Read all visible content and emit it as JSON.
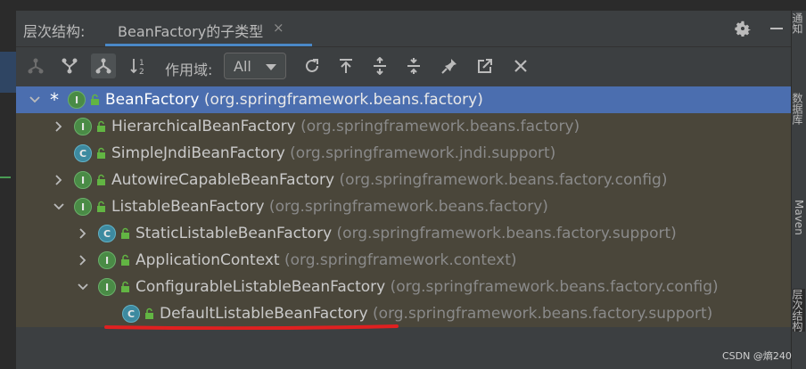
{
  "header": {
    "title": "层次结构:",
    "tab_label": "BeanFactory的子类型",
    "tab_close": "×"
  },
  "toolbar": {
    "scope_label": "作用域:",
    "scope_value": "All"
  },
  "tree": [
    {
      "kind": "I",
      "name": "BeanFactory",
      "pkg": "(org.springframework.beans.factory)",
      "expanded": true,
      "selected": true,
      "star": "*"
    },
    {
      "kind": "I",
      "name": "HierarchicalBeanFactory",
      "pkg": "(org.springframework.beans.factory)",
      "expanded": false
    },
    {
      "kind": "C",
      "name": "SimpleJndiBeanFactory",
      "pkg": "(org.springframework.jndi.support)"
    },
    {
      "kind": "I",
      "name": "AutowireCapableBeanFactory",
      "pkg": "(org.springframework.beans.factory.config)",
      "expanded": false
    },
    {
      "kind": "I",
      "name": "ListableBeanFactory",
      "pkg": "(org.springframework.beans.factory)",
      "expanded": true
    },
    {
      "kind": "C",
      "name": "StaticListableBeanFactory",
      "pkg": "(org.springframework.beans.factory.support)",
      "expanded": false
    },
    {
      "kind": "I",
      "name": "ApplicationContext",
      "pkg": "(org.springframework.context)",
      "expanded": false
    },
    {
      "kind": "I",
      "name": "ConfigurableListableBeanFactory",
      "pkg": "(org.springframework.beans.factory.config)",
      "expanded": true
    },
    {
      "kind": "C",
      "name": "DefaultListableBeanFactory",
      "pkg": "(org.springframework.beans.factory.support)"
    }
  ],
  "right_tabs": [
    "通知",
    "数据库",
    "Maven",
    "层次结构"
  ],
  "watermark": "CSDN @熵240",
  "colors": {
    "selection": "#4b6eaf",
    "tree_bg": "#4a463a",
    "interface_badge": "#4a8b46",
    "class_badge": "#3d8aa0",
    "annotation_red": "#e02020",
    "tab_underline": "#4a88c7"
  },
  "icons": {
    "toolbar": [
      "supertypes-icon",
      "subtypes-icon",
      "hierarchy-icon",
      "sort-alpha-icon",
      "refresh-icon",
      "export-icon",
      "expand-all-icon",
      "collapse-all-icon",
      "pin-icon",
      "open-in-editor-icon",
      "close-icon"
    ]
  }
}
